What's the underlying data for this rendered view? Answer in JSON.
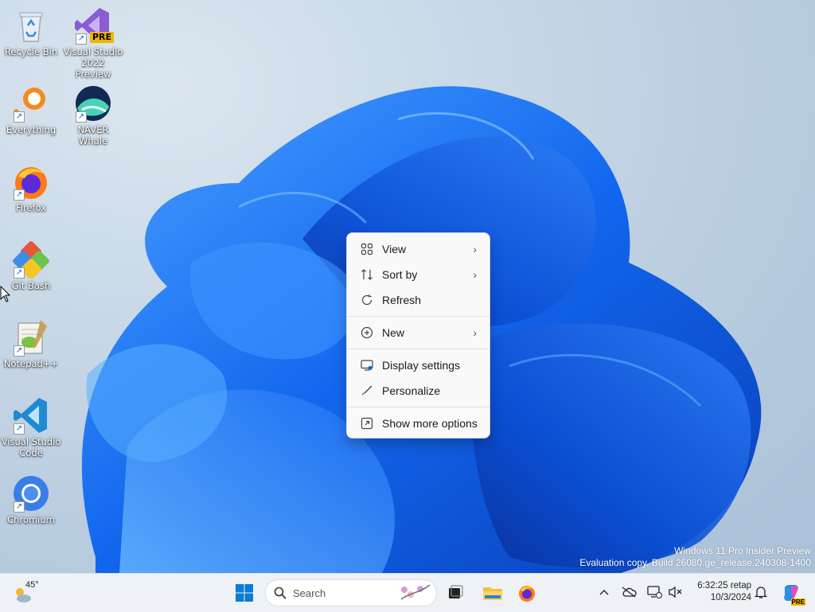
{
  "desktop": {
    "icons": [
      {
        "label": "Recycle Bin",
        "icon": "recycle-bin-icon"
      },
      {
        "label": "Visual Studio 2022 Preview",
        "icon": "visual-studio-preview-icon",
        "badge": "PRE"
      },
      {
        "label": "Everything",
        "icon": "everything-search-icon"
      },
      {
        "label": "NAVER Whale",
        "icon": "naver-whale-icon"
      },
      {
        "label": "Firefox",
        "icon": "firefox-icon"
      },
      {
        "label": "Git Bash",
        "icon": "git-bash-icon"
      },
      {
        "label": "Notepad++",
        "icon": "notepad-plus-plus-icon"
      },
      {
        "label": "Visual Studio Code",
        "icon": "vscode-icon"
      },
      {
        "label": "Chromium",
        "icon": "chromium-icon"
      }
    ]
  },
  "context_menu": {
    "items": [
      {
        "label": "View",
        "icon": "view-grid-icon",
        "submenu": true
      },
      {
        "label": "Sort by",
        "icon": "sort-icon",
        "submenu": true
      },
      {
        "label": "Refresh",
        "icon": "refresh-icon",
        "submenu": false
      },
      {
        "label": "New",
        "icon": "new-plus-icon",
        "submenu": true
      },
      {
        "label": "Display settings",
        "icon": "display-settings-icon",
        "submenu": false
      },
      {
        "label": "Personalize",
        "icon": "personalize-brush-icon",
        "submenu": false
      },
      {
        "label": "Show more options",
        "icon": "show-more-options-icon",
        "submenu": false
      }
    ]
  },
  "watermark": {
    "line1": "Windows 11 Pro Insider Preview",
    "line2": "Evaluation copy. Build 26080.ge_release.240308-1400"
  },
  "taskbar": {
    "weather_temp": "45°",
    "search_placeholder": "Search",
    "clock_time": "6:32:25 retap",
    "clock_date": "10/3/2024",
    "copilot_badge": "PRE"
  },
  "colors": {
    "accent": "#0067c0",
    "wallpaper_bloom": "#1a6cf0",
    "taskbar_bg": "#eef2f6",
    "menu_bg": "#f9f9f9"
  }
}
